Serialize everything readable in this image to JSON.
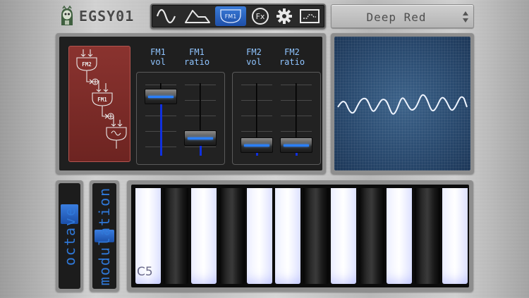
{
  "app": {
    "logo_text": "EGSY01"
  },
  "toolbar": {
    "tabs": [
      {
        "id": "sine",
        "icon": "sine-wave-icon"
      },
      {
        "id": "envelope",
        "icon": "envelope-icon"
      },
      {
        "id": "fm1",
        "label": "FM1",
        "selected": true
      },
      {
        "id": "fx",
        "label": "Fx"
      },
      {
        "id": "settings",
        "icon": "gear-icon"
      },
      {
        "id": "screen",
        "icon": "display-icon"
      }
    ]
  },
  "preset": {
    "value": "Deep Red"
  },
  "fm_panel": {
    "fm1_vol": {
      "title": "FM1",
      "subtitle": "vol",
      "level": 0.85
    },
    "fm1_ratio": {
      "title": "FM1",
      "subtitle": "ratio",
      "level": 0.12
    },
    "fm2_vol": {
      "title": "FM2",
      "subtitle": "vol",
      "level": 0.0
    },
    "fm2_ratio": {
      "title": "FM2",
      "subtitle": "ratio",
      "level": 0.0
    },
    "algorithm": {
      "operators": [
        "FM2",
        "FM1"
      ]
    }
  },
  "controls": {
    "octave_label": "octave",
    "modulation_label": "modulation"
  },
  "keyboard": {
    "start_note": "C5"
  },
  "colors": {
    "accent_blue": "#2f78d8",
    "algorithm_red": "#7a2b28",
    "scope_blue": "#2e527a"
  }
}
